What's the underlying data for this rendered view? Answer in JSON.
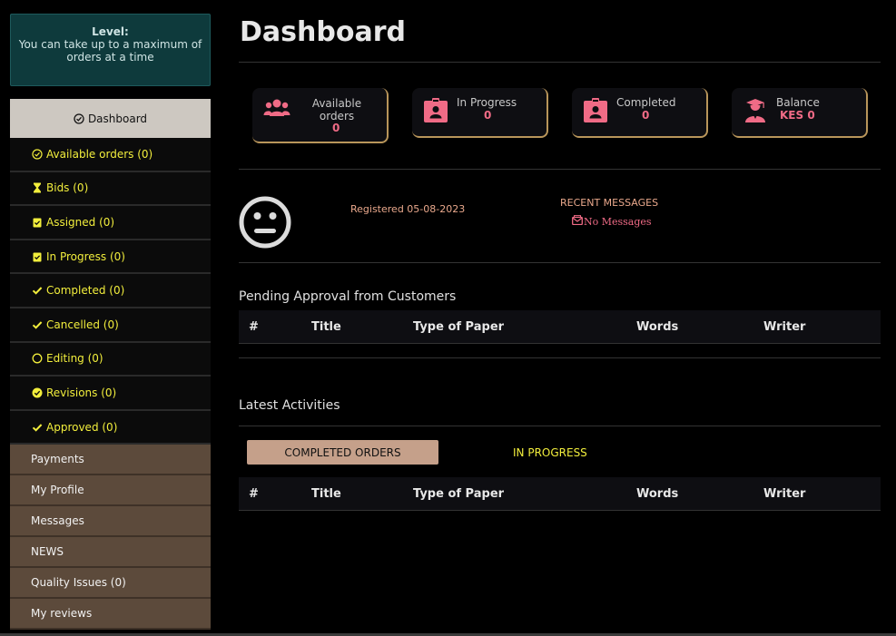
{
  "level": {
    "title": "Level:",
    "text": "You can take up to a maximum of orders at a time"
  },
  "sidebar": {
    "dashboard": "Dashboard",
    "items": [
      {
        "label": "Available orders (0)",
        "icon": "check-circle-icon"
      },
      {
        "label": "Bids (0)",
        "icon": "hourglass-icon"
      },
      {
        "label": "Assigned (0)",
        "icon": "clipboard-check-icon"
      },
      {
        "label": "In Progress (0)",
        "icon": "clipboard-check-icon"
      },
      {
        "label": "Completed (0)",
        "icon": "check-icon"
      },
      {
        "label": "Cancelled (0)",
        "icon": "check-icon"
      },
      {
        "label": "Editing (0)",
        "icon": "circle-icon"
      },
      {
        "label": "Revisions (0)",
        "icon": "check-circle-filled-icon"
      },
      {
        "label": "Approved (0)",
        "icon": "check-icon"
      }
    ],
    "links": [
      "Payments",
      "My Profile",
      "Messages",
      "NEWS",
      "Quality Issues (0)",
      "My reviews"
    ]
  },
  "page": {
    "title": "Dashboard"
  },
  "cards": {
    "available": {
      "label": "Available orders",
      "value": "0",
      "icon": "users-icon"
    },
    "in_progress": {
      "label": "In Progress",
      "value": "0",
      "icon": "id-badge-icon"
    },
    "completed": {
      "label": "Completed",
      "value": "0",
      "icon": "id-badge-icon"
    },
    "balance": {
      "label": "Balance",
      "value": "KES 0",
      "icon": "graduate-user-icon"
    }
  },
  "profile": {
    "registered": "Registered 05-08-2023",
    "recent_messages_heading": "RECENT MESSAGES",
    "no_messages": "No Messages"
  },
  "pending": {
    "heading": "Pending Approval from Customers",
    "columns": [
      "#",
      "Title",
      "Type of Paper",
      "Words",
      "Writer"
    ]
  },
  "activities": {
    "heading": "Latest Activities",
    "tab_completed": "COMPLETED ORDERS",
    "tab_in_progress": "IN PROGRESS",
    "columns": [
      "#",
      "Title",
      "Type of Paper",
      "Words",
      "Writer"
    ]
  },
  "colors": {
    "accent_yellow": "#f2ee3c",
    "accent_pink": "#f06b86",
    "card_border": "#b8955a",
    "sidebar_brown": "#5c4a3b",
    "level_teal": "#0e3a3c"
  }
}
